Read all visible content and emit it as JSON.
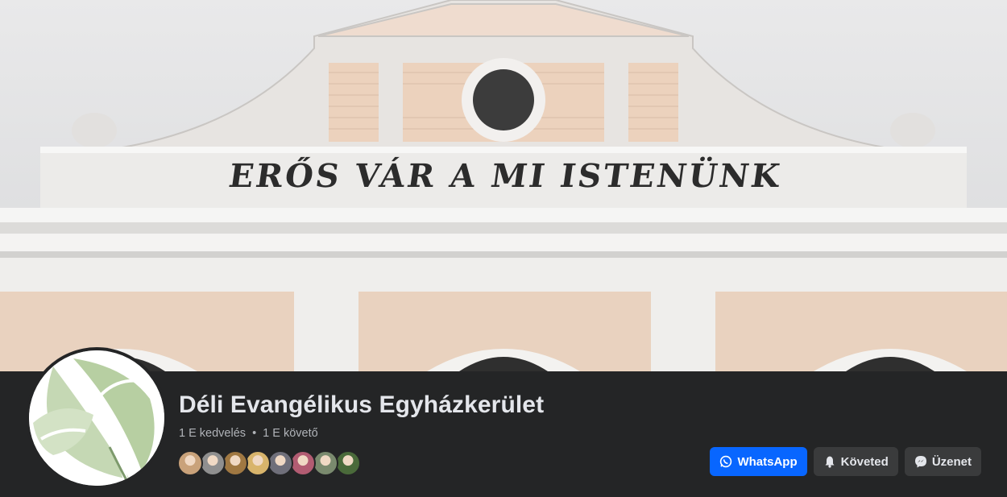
{
  "cover": {
    "inscription": "ERŐS VÁR A MI ISTENÜNK"
  },
  "page": {
    "name": "Déli Evangélikus Egyházkerület",
    "likes": "1 E kedvelés",
    "separator": "•",
    "followers": "1 E követő"
  },
  "follower_avatars": [
    {
      "color": "#c9a27a"
    },
    {
      "color": "#8f8f8f"
    },
    {
      "color": "#a07842"
    },
    {
      "color": "#d8b46b"
    },
    {
      "color": "#6f6f7a"
    },
    {
      "color": "#b25c72"
    },
    {
      "color": "#7a8a6e"
    },
    {
      "color": "#4a6a3a"
    }
  ],
  "actions": {
    "whatsapp_label": "WhatsApp",
    "following_label": "Követed",
    "message_label": "Üzenet"
  },
  "colors": {
    "primary_button": "#0866ff",
    "secondary_button": "#3a3b3c",
    "background": "#242526",
    "text_primary": "#e4e6eb",
    "text_secondary": "#b0b3b8"
  }
}
